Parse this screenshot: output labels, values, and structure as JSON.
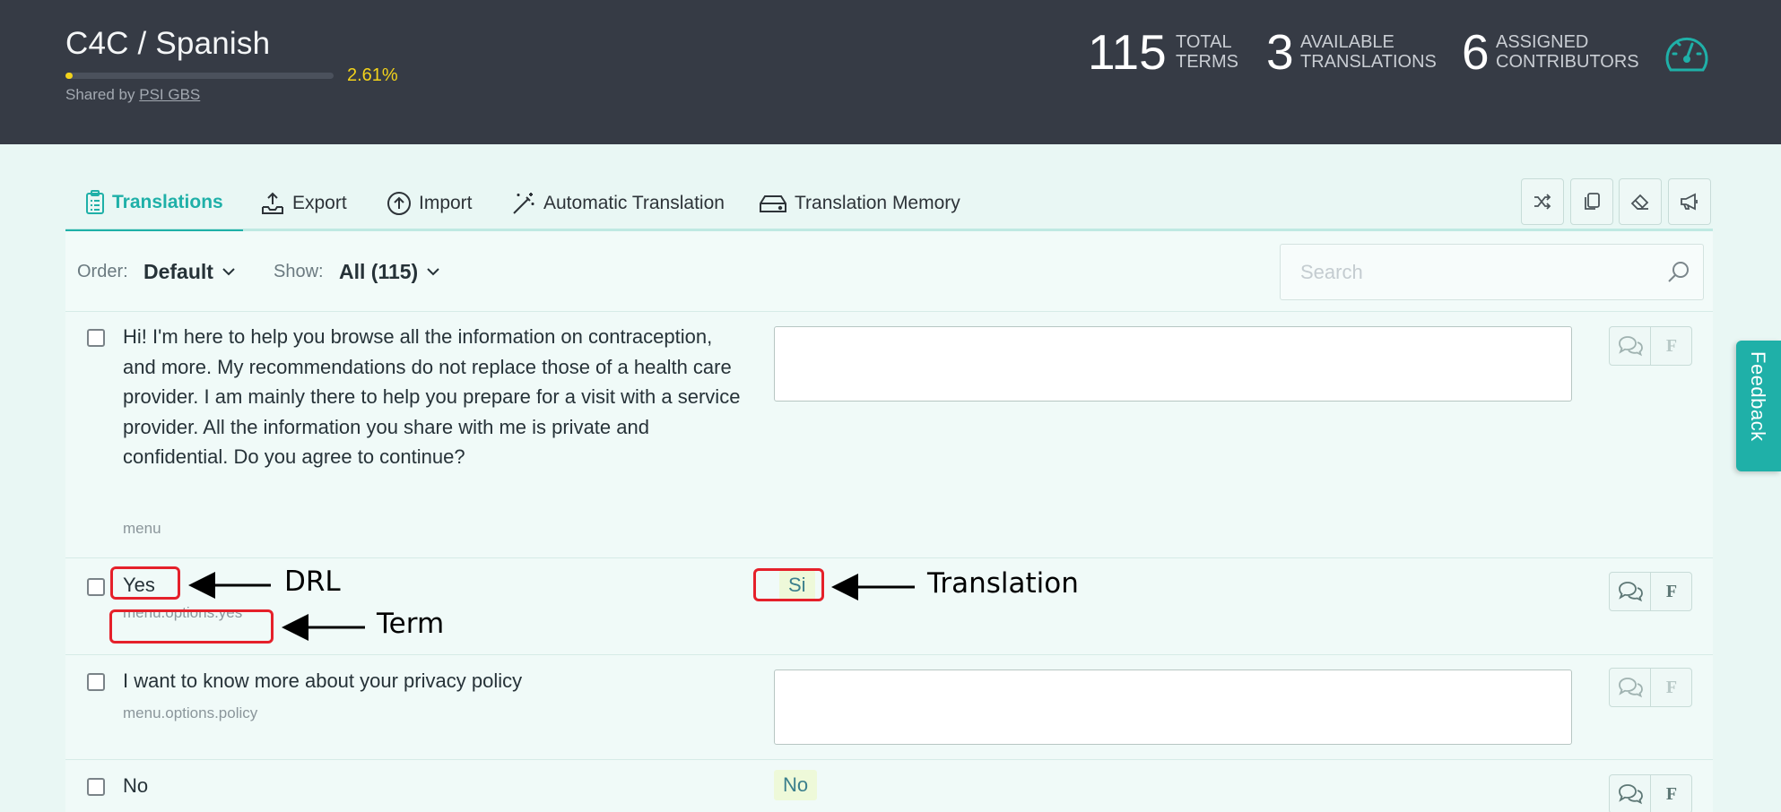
{
  "header": {
    "project_title": "C4C  / Spanish",
    "progress_percent_label": "2.61%",
    "progress_value_percent": 2.61,
    "shared_by_prefix": "Shared by",
    "shared_by_name": "PSI GBS",
    "stats": [
      {
        "value": "115",
        "label_line1": "TOTAL",
        "label_line2": "TERMS"
      },
      {
        "value": "3",
        "label_line1": "AVAILABLE",
        "label_line2": "TRANSLATIONS"
      },
      {
        "value": "6",
        "label_line1": "ASSIGNED",
        "label_line2": "CONTRIBUTORS"
      }
    ],
    "dashboard_icon": "gauge-icon"
  },
  "tabs": [
    {
      "label": "Translations",
      "icon": "clipboard-list-icon",
      "active": true
    },
    {
      "label": "Export",
      "icon": "export-tray-icon",
      "active": false
    },
    {
      "label": "Import",
      "icon": "upload-circle-icon",
      "active": false
    },
    {
      "label": "Automatic Translation",
      "icon": "magic-wand-icon",
      "active": false
    },
    {
      "label": "Translation Memory",
      "icon": "hard-drive-icon",
      "active": false
    }
  ],
  "toolbar_icons": [
    "shuffle-icon",
    "copy-icon",
    "eraser-icon",
    "megaphone-icon"
  ],
  "filters": {
    "order_label": "Order:",
    "order_value": "Default",
    "show_label": "Show:",
    "show_value": "All (115)",
    "search_placeholder": "Search"
  },
  "terms": [
    {
      "source": "Hi! I'm here to help you browse all the information on contraception, and more. My recommendations do not replace those of a health care provider. I am mainly there to help you prepare for a visit with a service provider. All the information you share with me is private and confidential. Do you agree to continue?",
      "key": "menu",
      "translation": ""
    },
    {
      "source": "Yes",
      "key": "menu.options.yes",
      "translation": "Si"
    },
    {
      "source": "I want to know more about your privacy policy",
      "key": "menu.options.policy",
      "translation": ""
    },
    {
      "source": "No",
      "key": "",
      "translation": "No"
    }
  ],
  "row_actions": {
    "comment_icon": "comments-icon",
    "flag_label": "F"
  },
  "feedback_label": "Feedback",
  "annotations": {
    "drl": "DRL",
    "term": "Term",
    "translation": "Translation"
  },
  "colors": {
    "header_bg": "#363b45",
    "accent": "#1fb0a8",
    "progress": "#f2d21b",
    "page_bg": "#e9f7f4",
    "annotation": "#e5202a"
  }
}
